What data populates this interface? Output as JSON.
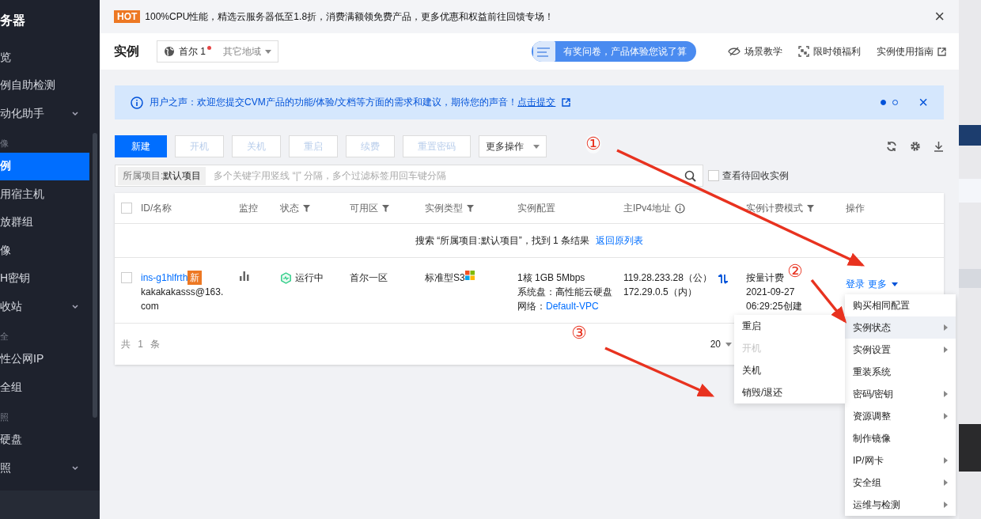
{
  "sidebar": {
    "title": "务器",
    "items": [
      {
        "kind": "item",
        "label": "览",
        "selected": false
      },
      {
        "kind": "item",
        "label": "例自助检测",
        "selected": false
      },
      {
        "kind": "group",
        "label": "动化助手",
        "selected": false
      },
      {
        "kind": "section",
        "label": "像"
      },
      {
        "kind": "item",
        "label": "例",
        "selected": true
      },
      {
        "kind": "item",
        "label": "用宿主机",
        "selected": false
      },
      {
        "kind": "item",
        "label": "放群组",
        "selected": false
      },
      {
        "kind": "item",
        "label": "像",
        "selected": false
      },
      {
        "kind": "item",
        "label": "H密钥",
        "selected": false
      },
      {
        "kind": "group",
        "label": "收站",
        "selected": false
      },
      {
        "kind": "section",
        "label": "全"
      },
      {
        "kind": "item",
        "label": "性公网IP",
        "selected": false
      },
      {
        "kind": "item",
        "label": "全组",
        "selected": false
      },
      {
        "kind": "section",
        "label": "照"
      },
      {
        "kind": "item",
        "label": "硬盘",
        "selected": false
      },
      {
        "kind": "group",
        "label": "照",
        "selected": false
      }
    ]
  },
  "promo": {
    "badge": "HOT",
    "text": "100%CPU性能，精选云服务器低至1.8折，消费满额领免费产品，更多优惠和权益前往回馈专场！",
    "close": "×"
  },
  "header": {
    "title": "实例",
    "region": "首尔 1",
    "other_region": "其它地域",
    "survey": "有奖问卷，产品体验您说了算",
    "links": [
      {
        "kind": "eye",
        "label": "场景教学"
      },
      {
        "kind": "qr",
        "label": "限时领福利"
      },
      {
        "kind": "external",
        "label": "实例使用指南"
      }
    ]
  },
  "notice": {
    "text": "用户之声：欢迎您提交CVM产品的功能/体验/文档等方面的需求和建议，期待您的声音！",
    "link": "点击提交",
    "dots": [
      {
        "selected": true
      },
      {
        "selected": false
      }
    ],
    "close": "×"
  },
  "toolbar": {
    "buttons": [
      {
        "kind": "primary",
        "label": "新建",
        "disabled": false
      },
      {
        "kind": "plain",
        "label": "开机",
        "disabled": true
      },
      {
        "kind": "plain",
        "label": "关机",
        "disabled": true
      },
      {
        "kind": "plain",
        "label": "重启",
        "disabled": true
      },
      {
        "kind": "plain",
        "label": "续费",
        "disabled": true
      },
      {
        "kind": "plain",
        "label": "重置密码",
        "disabled": true
      },
      {
        "kind": "dropdown",
        "label": "更多操作",
        "disabled": false
      }
    ]
  },
  "search": {
    "tag_key": "所属项目:",
    "tag_value": "默认项目",
    "placeholder": "多个关键字用竖线 “|” 分隔，多个过滤标签用回车键分隔",
    "recycle": {
      "label": "查看待回收实例",
      "checked": false
    }
  },
  "table": {
    "select_all": false,
    "columns": [
      {
        "label": "ID/名称",
        "filter": false,
        "info": false
      },
      {
        "label": "监控",
        "filter": false,
        "info": false
      },
      {
        "label": "状态",
        "filter": true,
        "info": false
      },
      {
        "label": "可用区",
        "filter": true,
        "info": false
      },
      {
        "label": "实例类型",
        "filter": true,
        "info": false
      },
      {
        "label": "实例配置",
        "filter": false,
        "info": false
      },
      {
        "label": "主IPv4地址",
        "filter": false,
        "info": true
      },
      {
        "label": "实例计费模式",
        "filter": true,
        "info": false
      },
      {
        "label": "操作",
        "filter": false,
        "info": false
      }
    ],
    "result": {
      "text": "搜索 “所属项目:默认项目”，找到 1 条结果",
      "link": "返回原列表"
    },
    "rows": [
      {
        "checked": false,
        "id": "ins-g1hlfrth",
        "badge": "新",
        "name": "kakakakasss@163.com",
        "status": "运行中",
        "zone": "首尔一区",
        "type": "标准型S3",
        "config": [
          "1核 1GB 5Mbps",
          "系统盘：高性能云硬盘"
        ],
        "network_label": "网络：",
        "network": "Default-VPC",
        "ips": [
          "119.28.233.28（公）",
          "172.29.0.5（内）"
        ],
        "billing": [
          "按量计费",
          "2021-09-27",
          "06:29:25创建"
        ],
        "login": "登录",
        "more": "更多"
      }
    ],
    "total": "共 1 条",
    "page_size": "20"
  },
  "menu": {
    "items": [
      {
        "label": "购买相同配置",
        "submenu": false,
        "selected": false
      },
      {
        "label": "实例状态",
        "submenu": true,
        "selected": true
      },
      {
        "label": "实例设置",
        "submenu": true,
        "selected": false
      },
      {
        "label": "重装系统",
        "submenu": false,
        "selected": false
      },
      {
        "label": "密码/密钥",
        "submenu": true,
        "selected": false
      },
      {
        "label": "资源调整",
        "submenu": true,
        "selected": false
      },
      {
        "label": "制作镜像",
        "submenu": false,
        "selected": false
      },
      {
        "label": "IP/网卡",
        "submenu": true,
        "selected": false
      },
      {
        "label": "安全组",
        "submenu": true,
        "selected": false
      },
      {
        "label": "运维与检测",
        "submenu": true,
        "selected": false
      }
    ],
    "submenu": [
      {
        "label": "重启",
        "disabled": false
      },
      {
        "label": "开机",
        "disabled": true
      },
      {
        "label": "关机",
        "disabled": false
      },
      {
        "label": "销毁/退还",
        "disabled": false
      }
    ]
  },
  "annotations": [
    {
      "label": "①"
    },
    {
      "label": "②"
    },
    {
      "label": "③"
    }
  ]
}
